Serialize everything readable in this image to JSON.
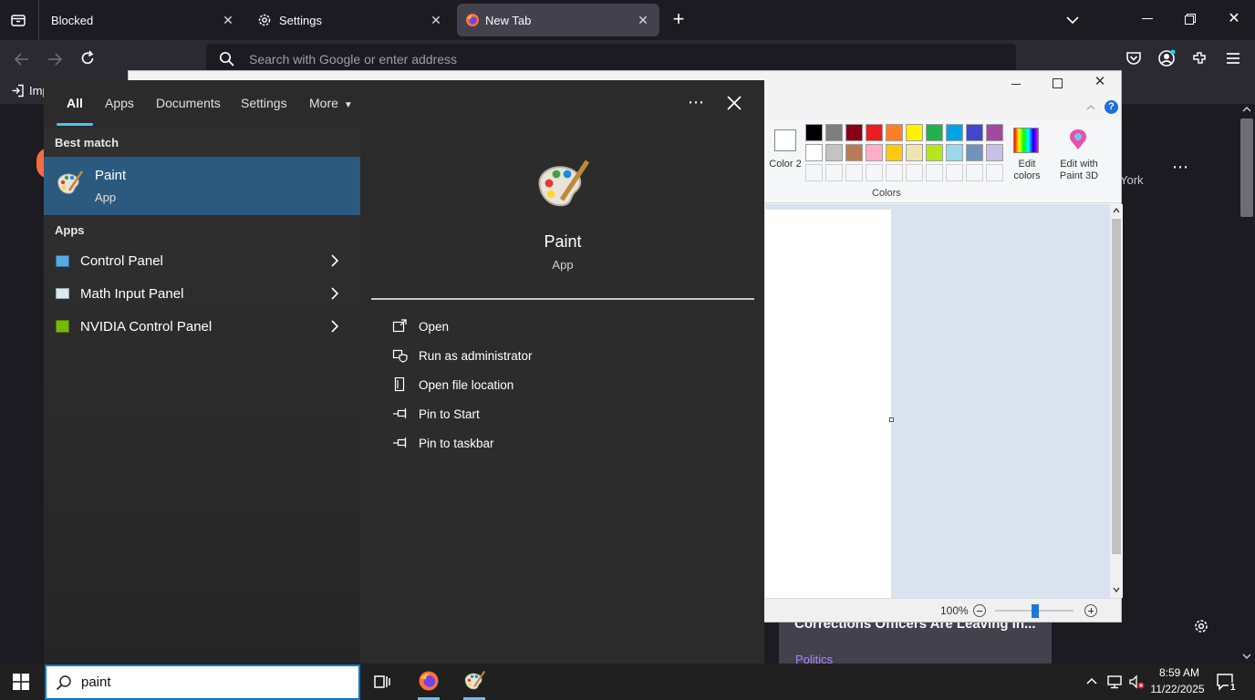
{
  "browser": {
    "tabs": [
      {
        "label": "Blocked"
      },
      {
        "label": "Settings"
      },
      {
        "label": "New Tab"
      }
    ],
    "urlbar_placeholder": "Search with Google or enter address",
    "bookmark_partial": "Imp",
    "page_snippets": {
      "headline": "Corrections Officers Are Leaving In...",
      "category": "Politics",
      "side_text": "York"
    }
  },
  "paint": {
    "color2_label": "Color 2",
    "colors_group": "Colors",
    "edit_colors": "Edit colors",
    "edit_3d": "Edit with Paint 3D",
    "zoom": "100%",
    "palette_row1": [
      "#000000",
      "#7f7f7f",
      "#880015",
      "#ed1c24",
      "#ff7f27",
      "#fff200",
      "#22b14c",
      "#00a2e8",
      "#3f48cc",
      "#a349a4"
    ],
    "palette_row2": [
      "#ffffff",
      "#c3c3c3",
      "#b97a57",
      "#ffaec9",
      "#ffc90e",
      "#efe4b0",
      "#b5e61d",
      "#99d9ea",
      "#7092be",
      "#c8bfe7"
    ]
  },
  "search": {
    "scopes": [
      "All",
      "Apps",
      "Documents",
      "Settings",
      "More"
    ],
    "best_match_header": "Best match",
    "best_match": {
      "name": "Paint",
      "type": "App"
    },
    "apps_header": "Apps",
    "apps": [
      {
        "name": "Control Panel"
      },
      {
        "name": "Math Input Panel"
      },
      {
        "name": "NVIDIA Control Panel"
      }
    ],
    "preview": {
      "name": "Paint",
      "type": "App"
    },
    "actions": [
      {
        "label": "Open",
        "icon": "open-icon"
      },
      {
        "label": "Run as administrator",
        "icon": "shield-icon"
      },
      {
        "label": "Open file location",
        "icon": "file-location-icon"
      },
      {
        "label": "Pin to Start",
        "icon": "pin-icon"
      },
      {
        "label": "Pin to taskbar",
        "icon": "pin-icon"
      }
    ],
    "query": "paint"
  },
  "taskbar": {
    "time": "8:59 AM",
    "date": "11/22/2025",
    "notification_count": "1"
  }
}
